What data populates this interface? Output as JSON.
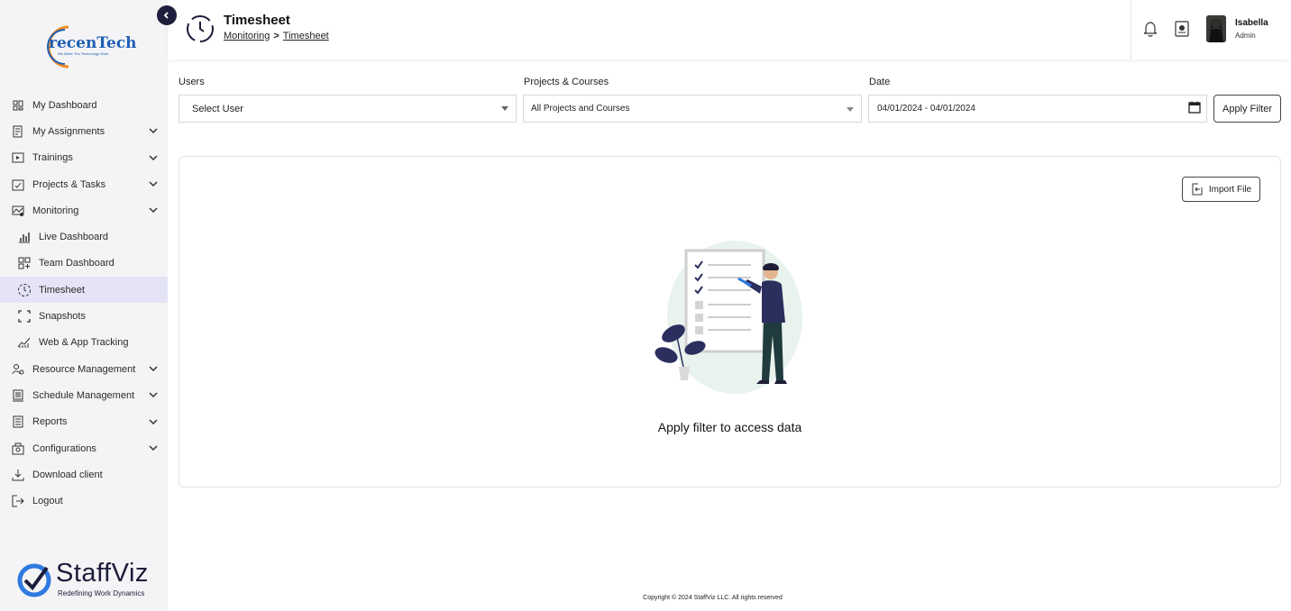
{
  "brand": {
    "logo_text": "recenTech",
    "logo_tagline": "We Make The Technology Work",
    "product_name": "StaffViz",
    "product_tagline": "Redefining Work Dynamics",
    "accent_color": "#1f1f3d",
    "logo_orange": "#f28c28",
    "logo_blue": "#1e5fb4"
  },
  "sidebar": {
    "items": [
      {
        "label": "My Dashboard",
        "icon": "dashboard-grid-icon",
        "expandable": false
      },
      {
        "label": "My Assignments",
        "icon": "assignments-icon",
        "expandable": true
      },
      {
        "label": "Trainings",
        "icon": "play-screen-icon",
        "expandable": true
      },
      {
        "label": "Projects & Tasks",
        "icon": "clipboard-check-icon",
        "expandable": true
      },
      {
        "label": "Monitoring",
        "icon": "monitoring-icon",
        "expandable": true
      },
      {
        "label": "Live Dashboard",
        "icon": "bar-chart-icon",
        "sub": true
      },
      {
        "label": "Team Dashboard",
        "icon": "team-grid-icon",
        "sub": true
      },
      {
        "label": "Timesheet",
        "icon": "clock-dashed-icon",
        "sub": true,
        "active": true
      },
      {
        "label": "Snapshots",
        "icon": "screenshot-frame-icon",
        "sub": true
      },
      {
        "label": "Web & App Tracking",
        "icon": "trend-chart-icon",
        "sub": true
      },
      {
        "label": "Resource Management",
        "icon": "people-icon",
        "expandable": true
      },
      {
        "label": "Schedule Management",
        "icon": "calendar-book-icon",
        "expandable": true
      },
      {
        "label": "Reports",
        "icon": "report-document-icon",
        "expandable": true
      },
      {
        "label": "Configurations",
        "icon": "configurations-icon",
        "expandable": true
      },
      {
        "label": "Download client",
        "icon": "download-icon",
        "expandable": false
      },
      {
        "label": "Logout",
        "icon": "logout-icon",
        "expandable": false
      }
    ]
  },
  "header": {
    "title": "Timesheet",
    "breadcrumb": [
      "Monitoring",
      "Timesheet"
    ],
    "breadcrumb_separator": ">",
    "user": {
      "name": "Isabella",
      "role": "Admin"
    }
  },
  "filters": {
    "users_label": "Users",
    "users_value": "Select User",
    "projects_label": "Projects & Courses",
    "projects_value": "All Projects and Courses",
    "date_label": "Date",
    "date_value": "04/01/2024 - 04/01/2024",
    "apply_label": "Apply Filter"
  },
  "content": {
    "import_label": "Import File",
    "empty_message": "Apply filter to access data"
  },
  "footer": {
    "copyright": "Copyright © 2024 StaffViz LLC. All rights reserved"
  }
}
